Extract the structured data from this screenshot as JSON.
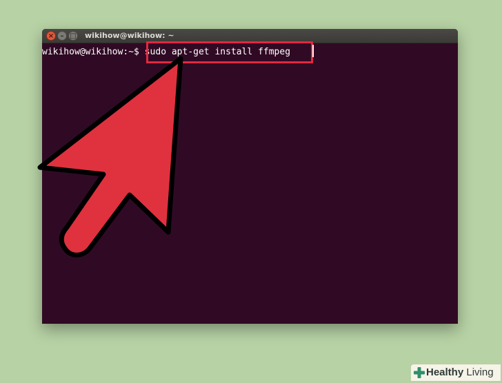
{
  "window": {
    "title": "wikihow@wikihow: ~",
    "close_glyph": "×",
    "minimize_glyph": "–",
    "maximize_glyph": "□"
  },
  "terminal": {
    "prompt": "wikihow@wikihow:~$ ",
    "command": "sudo apt-get install ffmpeg"
  },
  "highlight": {
    "color": "#e0293e"
  },
  "arrow": {
    "fill": "#e0313f",
    "stroke": "#000000"
  },
  "watermark": {
    "word1": "Healthy",
    "word2": " Living",
    "icon": "health-cross-icon"
  },
  "colors": {
    "background": "#b7d2a5",
    "terminal_bg": "#300a24",
    "text": "#ffffff"
  }
}
